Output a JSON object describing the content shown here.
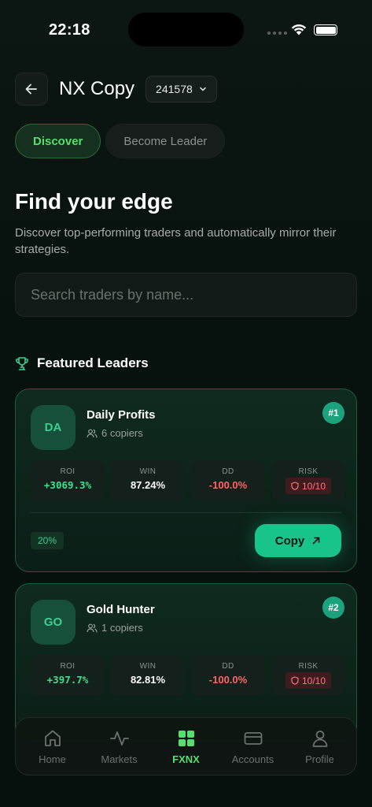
{
  "status_bar": {
    "time": "22:18"
  },
  "header": {
    "title": "NX Copy",
    "account_id": "241578"
  },
  "tabs": [
    {
      "label": "Discover",
      "active": true
    },
    {
      "label": "Become Leader",
      "active": false
    }
  ],
  "hero": {
    "title": "Find your edge",
    "subtitle": "Discover top-performing traders and automatically mirror their strategies."
  },
  "search": {
    "placeholder": "Search traders by name..."
  },
  "featured": {
    "title": "Featured Leaders",
    "leaders": [
      {
        "initials": "DA",
        "name": "Daily Profits",
        "copiers": "6 copiers",
        "rank": "#1",
        "stats": {
          "roi_label": "ROI",
          "roi": "+3069.3%",
          "win_label": "WIN",
          "win": "87.24%",
          "dd_label": "DD",
          "dd": "-100.0%",
          "risk_label": "RISK",
          "risk": "10/10"
        },
        "fee": "20%",
        "copy_label": "Copy"
      },
      {
        "initials": "GO",
        "name": "Gold Hunter",
        "copiers": "1 copiers",
        "rank": "#2",
        "stats": {
          "roi_label": "ROI",
          "roi": "+397.7%",
          "win_label": "WIN",
          "win": "82.81%",
          "dd_label": "DD",
          "dd": "-100.0%",
          "risk_label": "RISK",
          "risk": "10/10"
        }
      }
    ]
  },
  "nav": [
    {
      "label": "Home",
      "icon": "home-icon",
      "active": false
    },
    {
      "label": "Markets",
      "icon": "activity-icon",
      "active": false
    },
    {
      "label": "FXNX",
      "icon": "grid-icon",
      "active": true
    },
    {
      "label": "Accounts",
      "icon": "card-icon",
      "active": false
    },
    {
      "label": "Profile",
      "icon": "user-icon",
      "active": false
    }
  ],
  "colors": {
    "accent": "#18c48a",
    "active_tab": "#54e06c",
    "negative": "#ff6464",
    "positive": "#3fe08e"
  }
}
